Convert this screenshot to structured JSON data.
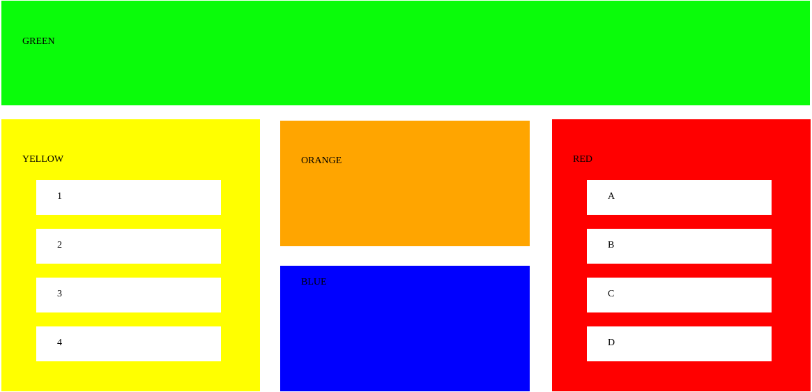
{
  "panels": {
    "green": {
      "label": "GREEN",
      "color": "#0afc0a"
    },
    "yellow": {
      "label": "YELLOW",
      "color": "#ffff00",
      "items": [
        "1",
        "2",
        "3",
        "4"
      ]
    },
    "orange": {
      "label": "ORANGE",
      "color": "#ffa500"
    },
    "blue": {
      "label": "BLUE",
      "color": "#0000ff"
    },
    "red": {
      "label": "RED",
      "color": "#ff0000",
      "items": [
        "A",
        "B",
        "C",
        "D"
      ]
    }
  }
}
